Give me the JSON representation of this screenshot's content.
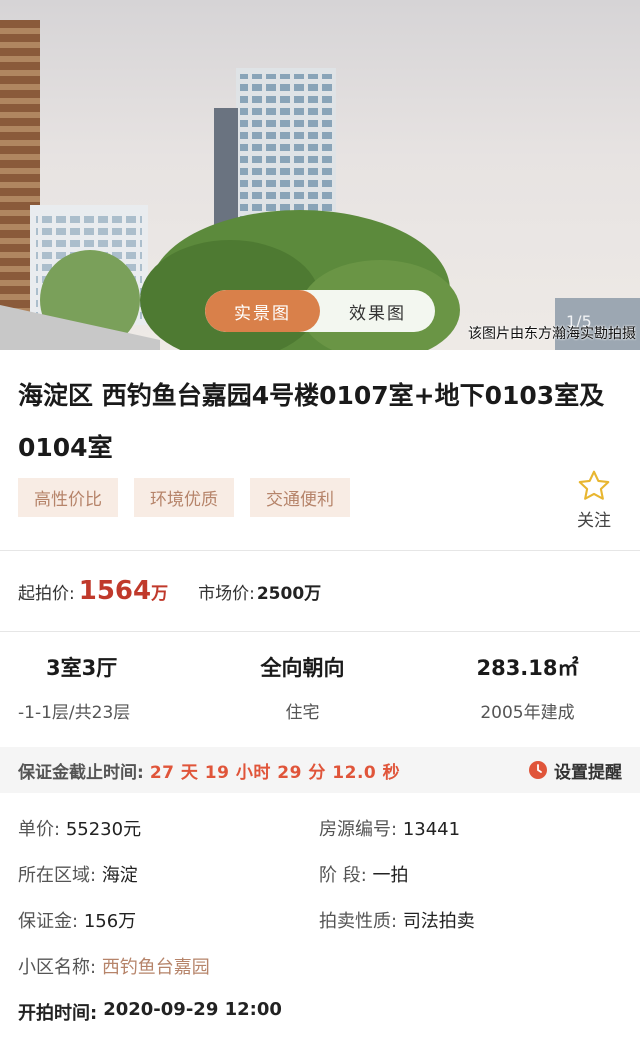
{
  "gallery": {
    "tabs": [
      "实景图",
      "效果图"
    ],
    "active_tab": 0,
    "counter": "1/5",
    "credit": "该图片由东方瀚海实勘拍摄"
  },
  "listing": {
    "title": "海淀区 西钓鱼台嘉园4号楼0107室+地下0103室及0104室",
    "tags": [
      "高性价比",
      "环境优质",
      "交通便利"
    ],
    "follow_label": "关注"
  },
  "price": {
    "start_label": "起拍价:",
    "start_value": "1564",
    "start_unit": "万",
    "market_label": "市场价:",
    "market_value": "2500万"
  },
  "stats": [
    {
      "main": "3室3厅",
      "sub": "-1-1层/共23层"
    },
    {
      "main": "全向朝向",
      "sub": "住宅"
    },
    {
      "main": "283.18㎡",
      "sub": "2005年建成"
    }
  ],
  "deadline": {
    "label": "保证金截止时间:",
    "value": "27 天 19 小时 29 分 12.0 秒",
    "reminder_label": "设置提醒"
  },
  "info": [
    [
      {
        "label": "单价:",
        "value": "55230元"
      },
      {
        "label": "房源编号:",
        "value": "13441"
      }
    ],
    [
      {
        "label": "所在区域:",
        "value": "海淀"
      },
      {
        "label": "阶 段:",
        "value": "一拍"
      }
    ],
    [
      {
        "label": "保证金:",
        "value": "156万"
      },
      {
        "label": "拍卖性质:",
        "value": "司法拍卖"
      }
    ]
  ],
  "community": {
    "label": "小区名称:",
    "value": "西钓鱼台嘉园"
  },
  "start_time": {
    "label": "开拍时间:",
    "value": "2020-09-29 12:00"
  },
  "colors": {
    "accent": "#d9804a",
    "price": "#c0392b",
    "countdown": "#e0553a",
    "tag_bg": "#f8ece4",
    "tag_text": "#b6846a"
  }
}
